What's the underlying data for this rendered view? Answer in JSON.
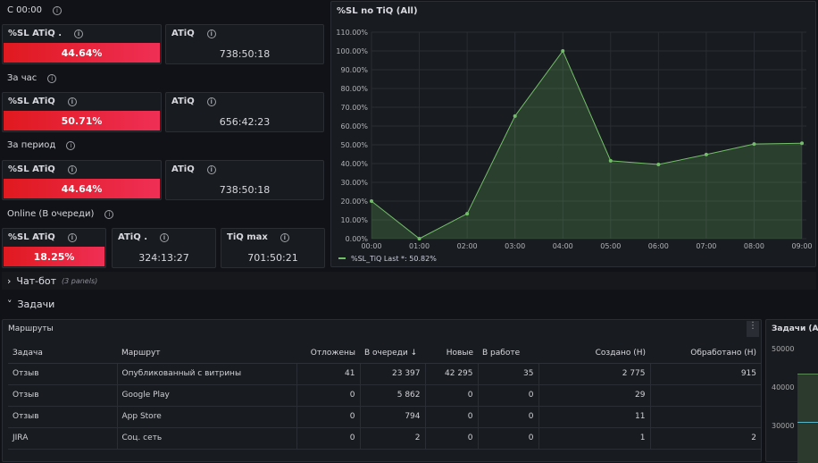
{
  "sections": [
    {
      "title": "С 00:00",
      "panels": [
        {
          "title": "%SL ATiQ .",
          "value": "44.64%",
          "type": "red"
        },
        {
          "title": "ATiQ",
          "value": "738:50:18"
        }
      ]
    },
    {
      "title": "За час",
      "panels": [
        {
          "title": "%SL ATiQ",
          "value": "50.71%",
          "type": "red"
        },
        {
          "title": "ATiQ",
          "value": "656:42:23"
        }
      ]
    },
    {
      "title": "За период",
      "panels": [
        {
          "title": "%SL ATiQ",
          "value": "44.64%",
          "type": "red"
        },
        {
          "title": "ATiQ",
          "value": "738:50:18"
        }
      ]
    },
    {
      "title": "Online (В очереди)",
      "panels": [
        {
          "title": "%SL ATiQ",
          "value": "18.25%",
          "type": "red"
        },
        {
          "title": "ATiQ .",
          "value": "324:13:27"
        },
        {
          "title": "TiQ max",
          "value": "701:50:21"
        }
      ]
    }
  ],
  "rows": {
    "chatbot": {
      "title": "Чат-бот",
      "count": "(3 panels)"
    },
    "tasks": {
      "title": "Задачи"
    }
  },
  "chart_data": {
    "type": "area",
    "title": "%SL no TiQ (All)",
    "x": [
      "00:00",
      "01:00",
      "02:00",
      "03:00",
      "04:00",
      "05:00",
      "06:00",
      "07:00",
      "08:00",
      "09:00"
    ],
    "series": [
      {
        "name": "%SL_TiQ",
        "values": [
          20,
          0,
          13.3,
          65.3,
          100,
          41.5,
          39.5,
          44.8,
          50.4,
          50.82
        ],
        "color": "#73bf69"
      }
    ],
    "yticks": [
      "0.00%",
      "10.00%",
      "20.00%",
      "30.00%",
      "40.00%",
      "50.00%",
      "60.00%",
      "70.00%",
      "80.00%",
      "90.00%",
      "100.00%",
      "110.00%"
    ],
    "ylim": [
      0,
      110
    ],
    "grid": true,
    "legend": {
      "placement": "bottom-left",
      "text": "%SL_TiQ  Last *: 50.82%"
    }
  },
  "table": {
    "title": "Маршруты",
    "columns": [
      "Задача",
      "Маршрут",
      "Отложены",
      "В очереди ↓",
      "Новые",
      "В работе",
      "Создано (H)",
      "Обработано (H)"
    ],
    "rows": [
      [
        "Отзыв",
        "Опубликованный с витрины",
        "41",
        "23 397",
        "42 295",
        "35",
        "2 775",
        "915"
      ],
      [
        "Отзыв",
        "Google Play",
        "0",
        "5 862",
        "0",
        "0",
        "29",
        ""
      ],
      [
        "Отзыв",
        "App Store",
        "0",
        "794",
        "0",
        "0",
        "11",
        ""
      ],
      [
        "JIRA",
        "Соц. сеть",
        "0",
        "2",
        "0",
        "0",
        "1",
        "2"
      ]
    ]
  },
  "side_panel": {
    "title": "Задачи (All",
    "yticks": [
      "50000",
      "40000",
      "30000"
    ]
  }
}
